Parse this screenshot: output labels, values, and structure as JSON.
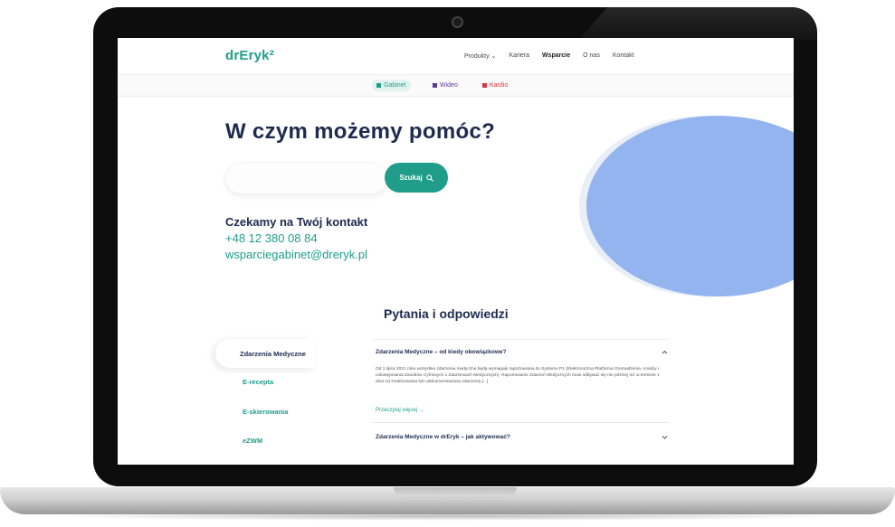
{
  "site": {
    "logo": "drEryk²",
    "nav": [
      "Produkty ⌄",
      "Kariera",
      "Wsparcie",
      "O nas",
      "Kontakt"
    ],
    "nav_active_index": 2,
    "products": [
      "Gabinet",
      "Wideo",
      "Kardio"
    ],
    "accent_color": "#1f9d8a",
    "heading_color": "#1d2b4f",
    "blob_color": "#93b4ef"
  },
  "hero": {
    "title": "W czym możemy pomóc?",
    "search_placeholder": "",
    "search_button": "Szukaj",
    "search_icon": "search-icon"
  },
  "contact": {
    "title": "Czekamy na Twój kontakt",
    "phone": "+48 12 380 08 84",
    "email": "wsparciegabinet@dreryk.pl"
  },
  "faq": {
    "title": "Pytania i odpowiedzi",
    "categories": [
      "Zdarzenia Medyczne",
      "E-recepta",
      "E-skierowania",
      "eZWM"
    ],
    "active_category_index": 0,
    "questions": [
      {
        "q": "Zdarzenia Medyczne – od kiedy obowiązkowe?",
        "expanded": true,
        "answer": "Od 1 lipca 2021 roku wszystkie zdarzenia medyczne będą wymagały raportowania do Systemu P1 (Elektroniczna Platforma Gromadzenia, Analizy i Udostępniania Zasobów Cyfrowych o Zdarzeniach Medycznych). Raportowanie Zdarzeń Medycznych musi odbywać się nie później niż w terminie 1 dnia od zrealizowania lub udokumentowania zdarzenia [...]",
        "more": "Przeczytaj więcej →"
      },
      {
        "q": "Zdarzenia Medyczne w drEryk – jak aktywować?",
        "expanded": false
      }
    ]
  }
}
